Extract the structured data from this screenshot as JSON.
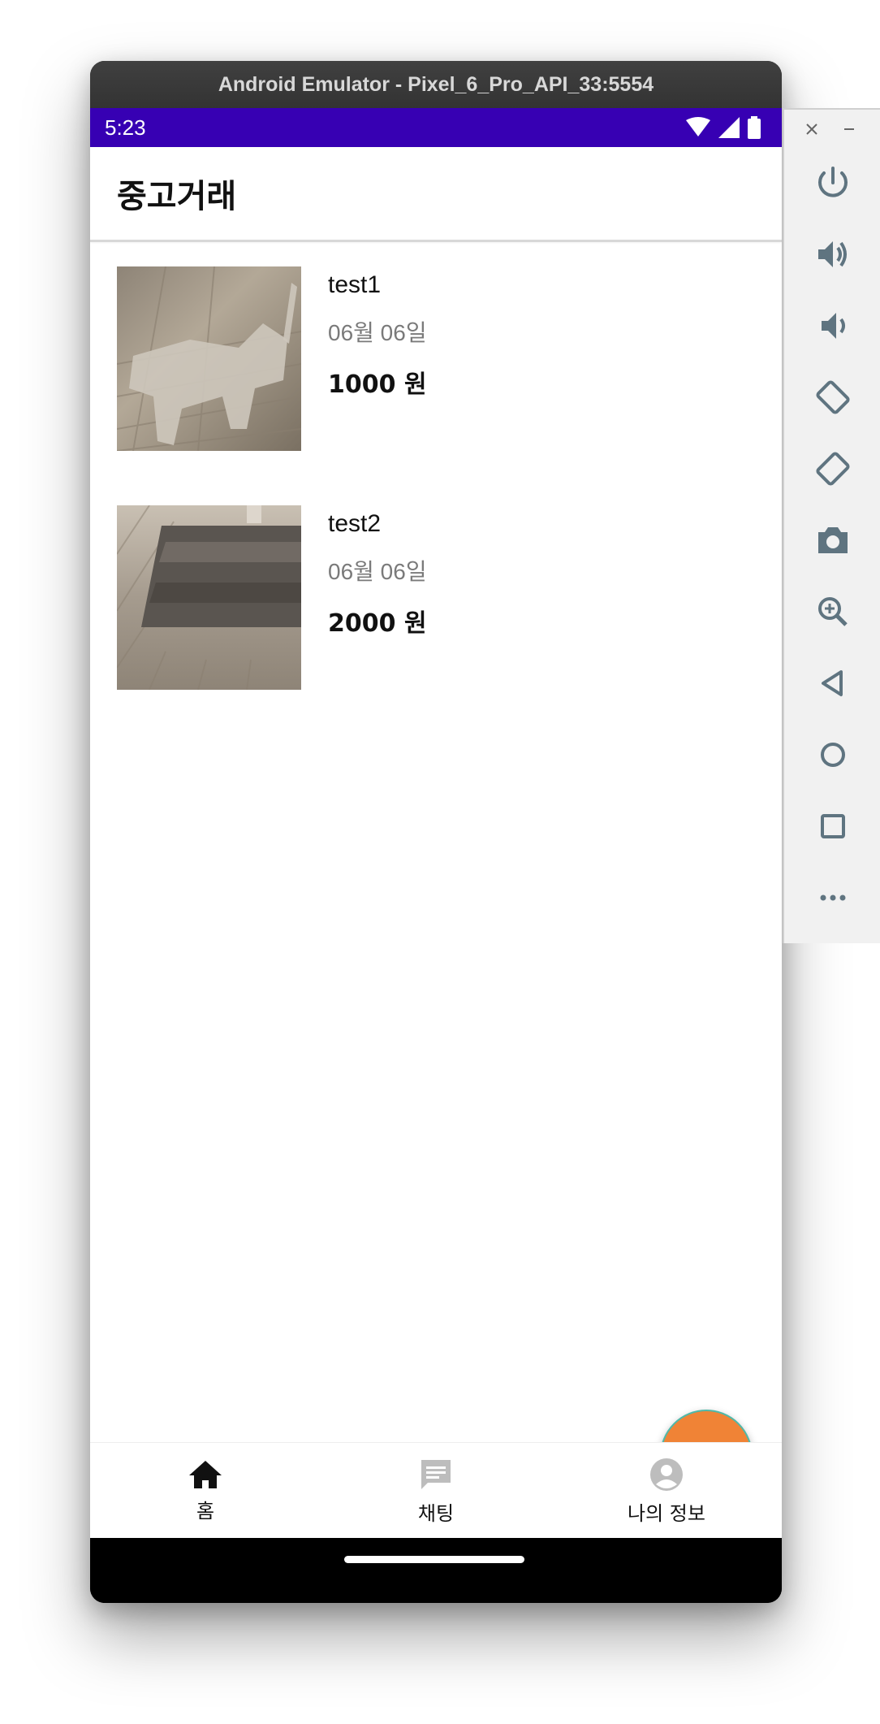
{
  "window": {
    "title": "Android Emulator - Pixel_6_Pro_API_33:5554"
  },
  "status_bar": {
    "time": "5:23"
  },
  "app_bar": {
    "title": "중고거래"
  },
  "items": [
    {
      "title": "test1",
      "date": "06월 06일",
      "price": "1000 원"
    },
    {
      "title": "test2",
      "date": "06월 06일",
      "price": "2000 원"
    }
  ],
  "bottom_nav": {
    "home": "홈",
    "chat": "채팅",
    "profile": "나의 정보"
  },
  "colors": {
    "status_bar": "#3700b3",
    "fab": "#f08336",
    "fab_border": "#4fb8a8"
  },
  "icons": {
    "fab": "plus-icon",
    "home": "home-icon",
    "chat": "chat-icon",
    "profile": "account-icon"
  },
  "sidebar": {
    "buttons": [
      "close-icon",
      "minimize-icon",
      "power-icon",
      "volume-up-icon",
      "volume-down-icon",
      "rotate-left-icon",
      "rotate-right-icon",
      "camera-icon",
      "zoom-icon",
      "back-icon",
      "home-circle-icon",
      "overview-icon",
      "more-icon"
    ]
  }
}
